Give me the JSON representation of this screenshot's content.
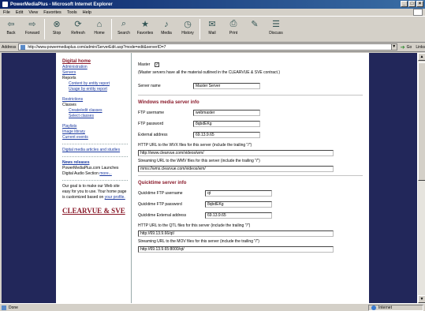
{
  "window": {
    "title": "PowerMediaPlus - Microsoft Internet Explorer",
    "controls": [
      "_",
      "□",
      "×"
    ]
  },
  "menu": [
    "File",
    "Edit",
    "View",
    "Favorites",
    "Tools",
    "Help"
  ],
  "toolbar": [
    {
      "label": "Back",
      "icon": "back-arrow-icon",
      "glyph": "⇦"
    },
    {
      "label": "Forward",
      "icon": "forward-arrow-icon",
      "glyph": "⇨"
    },
    {
      "label": "Stop",
      "icon": "stop-icon",
      "glyph": "⊗"
    },
    {
      "label": "Refresh",
      "icon": "refresh-icon",
      "glyph": "⟳"
    },
    {
      "label": "Home",
      "icon": "home-icon",
      "glyph": "⌂"
    },
    {
      "label": "Search",
      "icon": "search-icon",
      "glyph": "⌕"
    },
    {
      "label": "Favorites",
      "icon": "favorites-icon",
      "glyph": "★"
    },
    {
      "label": "Media",
      "icon": "media-icon",
      "glyph": "♪"
    },
    {
      "label": "History",
      "icon": "history-icon",
      "glyph": "◷"
    },
    {
      "label": "Mail",
      "icon": "mail-icon",
      "glyph": "✉"
    },
    {
      "label": "Print",
      "icon": "print-icon",
      "glyph": "⎙"
    },
    {
      "label": "",
      "icon": "edit-icon",
      "glyph": "✎"
    },
    {
      "label": "Discuss",
      "icon": "discuss-icon",
      "glyph": "☰"
    }
  ],
  "address": {
    "label": "Address",
    "url": "http://www.powermediaplus.com/admin/ServerEdit.asp?mode=edit&serverID=7",
    "go": "Go",
    "links": "Links"
  },
  "sidebar": {
    "title": "Digital home",
    "items": [
      {
        "text": "Administration",
        "link": true,
        "indent": false
      },
      {
        "text": "Servers",
        "link": true,
        "indent": false
      },
      {
        "text": "Reports",
        "link": false,
        "indent": false
      },
      {
        "text": "Content by entity report",
        "link": true,
        "indent": true
      },
      {
        "text": "Usage by entity report",
        "link": true,
        "indent": true
      },
      {
        "text": "",
        "gap": true
      },
      {
        "text": "Restrictions",
        "link": true,
        "indent": false
      },
      {
        "text": "Classes",
        "link": false,
        "indent": false
      },
      {
        "text": "Create/edit classes",
        "link": true,
        "indent": true
      },
      {
        "text": "Select classes",
        "link": true,
        "indent": true
      },
      {
        "text": "",
        "gap": true
      },
      {
        "text": "Playlists",
        "link": true,
        "indent": false
      },
      {
        "text": "Image library",
        "link": true,
        "indent": false
      },
      {
        "text": "Current events",
        "link": true,
        "indent": false
      }
    ],
    "articles_link": "Digital media articles and studies",
    "news_title": "News releases",
    "news_text": "PowerMediaPlus.com Launches Digital Audio Section",
    "news_more": "more...",
    "goal_text": "Our goal is to make our Web site easy for you to use. Your home page is customized based on",
    "goal_link": "your profile.",
    "logo": "CLEARVUE & SVE"
  },
  "form": {
    "master_label": "Master",
    "master_checked": true,
    "master_note": "(Master servers have all the material outlined in the CLEARVUE & SVE contract.)",
    "server_name_label": "Server name",
    "server_name_value": "Master Server",
    "wms_title": "Windows media server info",
    "ftp_user_label": "FTP username",
    "ftp_user_value": "webmaster",
    "ftp_pass_label": "FTP password",
    "ftp_pass_value": "8qbdEKg",
    "ext_addr_label": "External address",
    "ext_addr_value": "69.13.9.65",
    "wvx_label": "HTTP URL to the WVX files for this server (include the trailing \"/\")",
    "wvx_value": "http://www.clearvue.com/videos/wm/",
    "wmv_label": "Streaming URL to the WMV files for this server (include the trailing \"/\")",
    "wmv_value": "mms://wms.clearvue.com/videos/wm/",
    "qt_title": "Quicktime server info",
    "qt_user_label": "Quicktime FTP username",
    "qt_user_value": "qt",
    "qt_pass_label": "Quicktime FTP password",
    "qt_pass_value": "8qbdEKg",
    "qt_ext_label": "Quicktime External address",
    "qt_ext_value": "69.13.9.65",
    "qtl_label": "HTTP URL to the QTL files for this server (include the trailing \"/\")",
    "qtl_value": "http://69.13.9.66/qt/",
    "mov_label": "Streaming URL to the MOV files for this server (include the trailing \"/\")",
    "mov_value": "http://69.13.9.65:8000/qt/"
  },
  "status": {
    "text": "Done",
    "zone": "Internet"
  }
}
